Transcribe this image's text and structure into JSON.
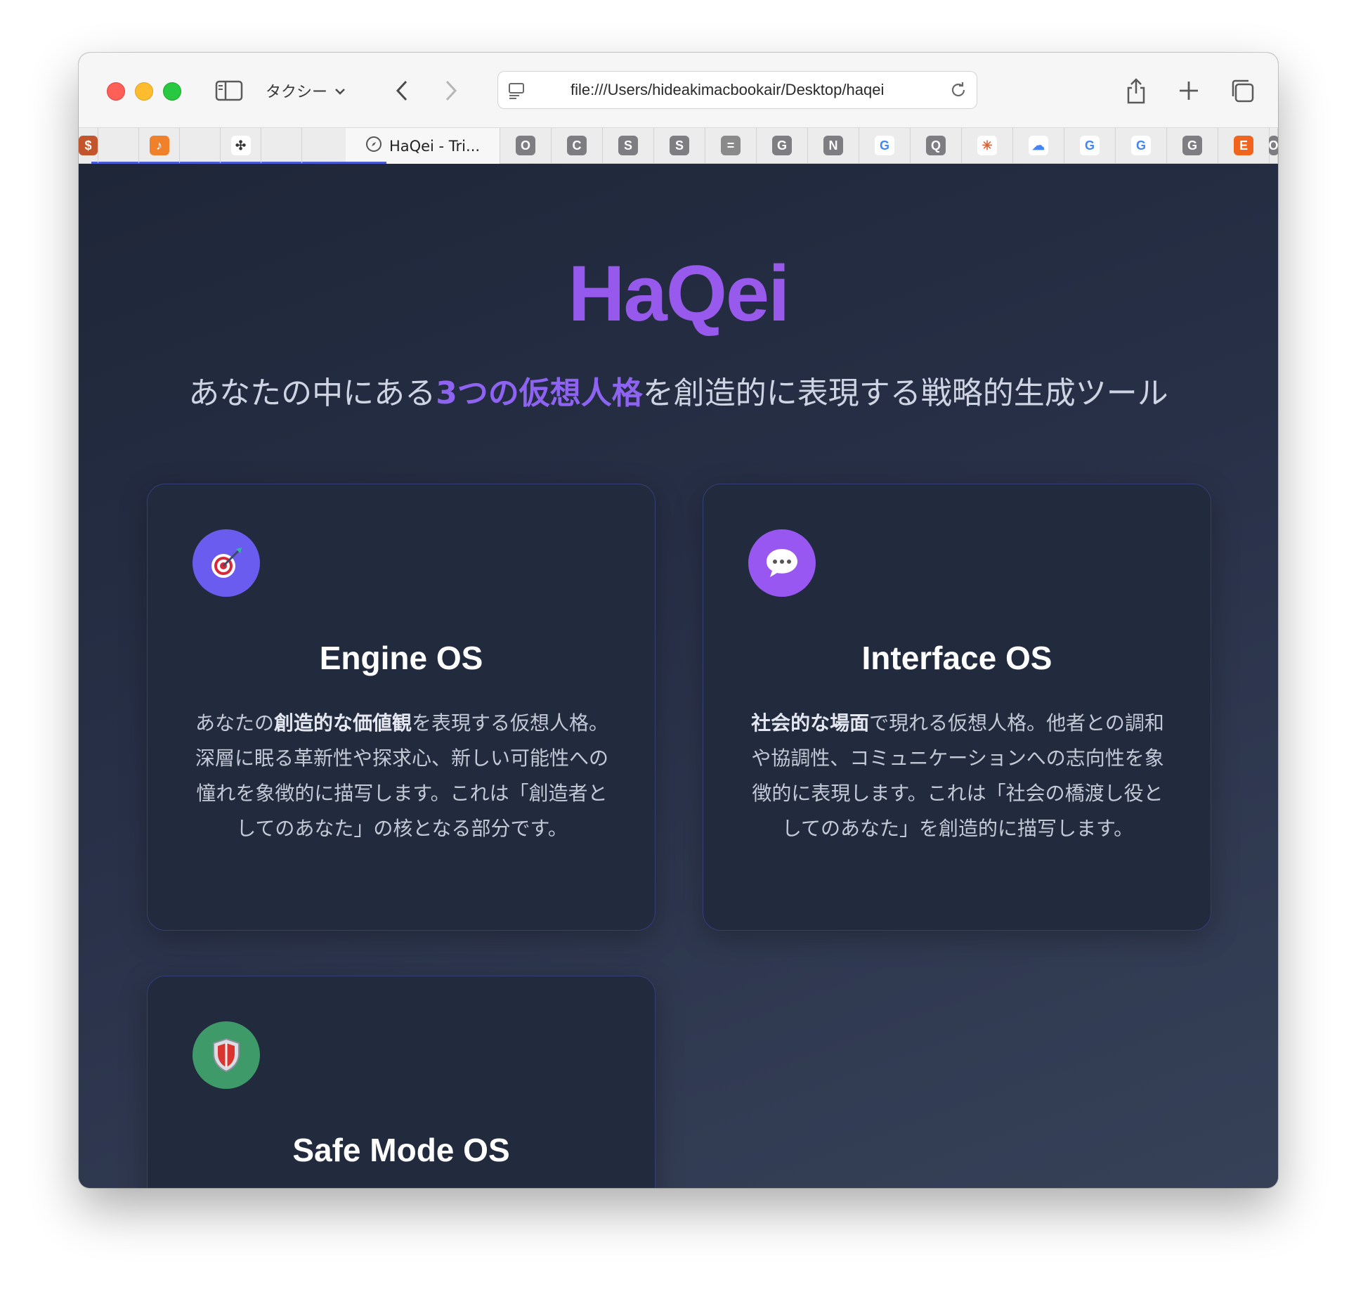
{
  "browser": {
    "tab_group_label": "タクシー",
    "url": "file:///Users/hideakimacbookair/Desktop/haqei",
    "active_tab_title": "HaQei - Tri...",
    "pinned_tabs": [
      {
        "icon": "dollar-scroll-icon",
        "glyph": "$"
      },
      {
        "icon": "microsoft-icon"
      },
      {
        "icon": "orange-app-icon",
        "glyph": "♪"
      },
      {
        "icon": "microsoft-icon"
      },
      {
        "icon": "puzzle-icon",
        "glyph": "✣"
      },
      {
        "icon": "microsoft-icon"
      }
    ],
    "more_tabs": [
      {
        "icon": "letter-o-icon",
        "glyph": "O"
      },
      {
        "icon": "letter-c-icon",
        "glyph": "C"
      },
      {
        "icon": "letter-s-icon",
        "glyph": "S"
      },
      {
        "icon": "letter-s-icon",
        "glyph": "S"
      },
      {
        "icon": "equals-icon",
        "glyph": "="
      },
      {
        "icon": "letter-g-icon",
        "glyph": "G"
      },
      {
        "icon": "letter-n-icon",
        "glyph": "N"
      },
      {
        "icon": "google-icon",
        "glyph": "G"
      },
      {
        "icon": "letter-q-icon",
        "glyph": "Q"
      },
      {
        "icon": "claude-icon",
        "glyph": "✳"
      },
      {
        "icon": "google-cloud-icon",
        "glyph": "☁"
      },
      {
        "icon": "google-icon",
        "glyph": "G"
      },
      {
        "icon": "google-icon",
        "glyph": "G"
      },
      {
        "icon": "letter-g-icon",
        "glyph": "G"
      },
      {
        "icon": "etsy-icon",
        "glyph": "E"
      },
      {
        "icon": "letter-o-icon",
        "glyph": "O"
      }
    ]
  },
  "hero": {
    "title": "HaQei",
    "subtitle_before": "あなたの中にある",
    "subtitle_highlight": "3つの仮想人格",
    "subtitle_after": "を創造的に表現する戦略的生成ツール"
  },
  "cards": [
    {
      "title": "Engine OS",
      "icon": "dart-target-icon",
      "desc_pre": "あなたの",
      "desc_bold": "創造的な価値観",
      "desc_post": "を表現する仮想人格。深層に眠る革新性や探求心、新しい可能性への憧れを象徴的に描写します。これは「創造者としてのあなた」の核となる部分です。"
    },
    {
      "title": "Interface OS",
      "icon": "speech-bubble-icon",
      "desc_pre": "",
      "desc_bold": "社会的な場面",
      "desc_post": "で現れる仮想人格。他者との調和や協調性、コミュニケーションへの志向性を象徴的に表現します。これは「社会の橋渡し役としてのあなた」を創造的に描写します。"
    },
    {
      "title": "Safe Mode OS",
      "icon": "shield-icon"
    }
  ],
  "colors": {
    "accent_purple": "#8f63f2",
    "engine_icon_bg": "#6b5cf0",
    "interface_icon_bg": "#9757f0",
    "safe_icon_bg": "#3f9a6a"
  }
}
